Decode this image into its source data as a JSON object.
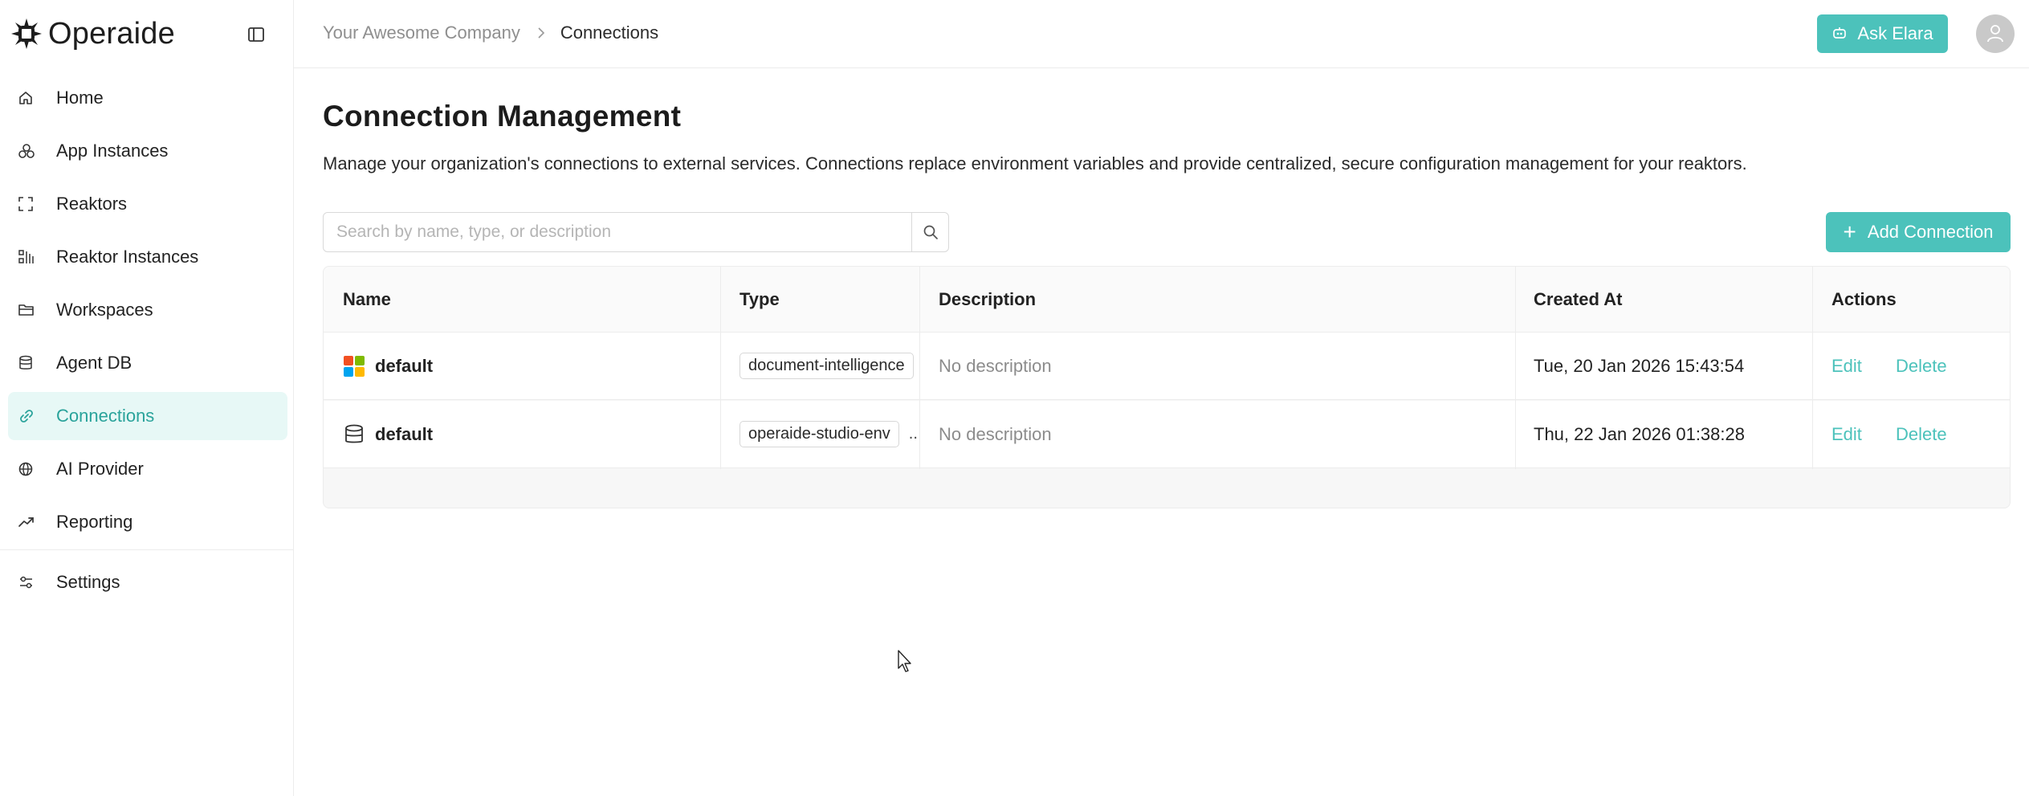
{
  "brand": {
    "name": "Operaide"
  },
  "sidebar": {
    "items": [
      {
        "label": "Home",
        "icon": "home-icon"
      },
      {
        "label": "App Instances",
        "icon": "app-instances-icon"
      },
      {
        "label": "Reaktors",
        "icon": "reaktors-icon"
      },
      {
        "label": "Reaktor Instances",
        "icon": "reaktor-instances-icon"
      },
      {
        "label": "Workspaces",
        "icon": "folder-icon"
      },
      {
        "label": "Agent DB",
        "icon": "database-icon"
      },
      {
        "label": "Connections",
        "icon": "link-icon",
        "active": true
      },
      {
        "label": "AI Provider",
        "icon": "globe-icon"
      },
      {
        "label": "Reporting",
        "icon": "trend-icon"
      },
      {
        "label": "Settings",
        "icon": "sliders-icon"
      }
    ]
  },
  "header": {
    "breadcrumb": [
      "Your Awesome Company",
      "Connections"
    ],
    "ask_label": "Ask Elara"
  },
  "main": {
    "title": "Connection Management",
    "description": "Manage your organization's connections to external services. Connections replace environment variables and provide centralized, secure configuration management for your reaktors.",
    "search_placeholder": "Search by name, type, or description",
    "add_label": "Add Connection"
  },
  "table": {
    "columns": [
      "Name",
      "Type",
      "Description",
      "Created At",
      "Actions"
    ],
    "rows": [
      {
        "name": "default",
        "icon": "microsoft-logo-icon",
        "type": "document-intelligence",
        "more": "",
        "description": "No description",
        "created": "Tue, 20 Jan 2026 15:43:54",
        "edit": "Edit",
        "delete": "Delete"
      },
      {
        "name": "default",
        "icon": "database-icon",
        "type": "operaide-studio-env",
        "more": "..",
        "description": "No description",
        "created": "Thu, 22 Jan 2026 01:38:28",
        "edit": "Edit",
        "delete": "Delete"
      }
    ]
  },
  "colors": {
    "accent": "#4cc2bb",
    "active_bg": "#e7f8f6",
    "active_text": "#2aa39b"
  }
}
